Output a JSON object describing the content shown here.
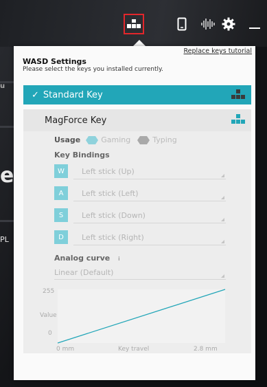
{
  "background": {
    "text_fragments": [
      "u",
      "e",
      "PL"
    ]
  },
  "topbar": {
    "icons": [
      {
        "name": "keyboard-layout-icon",
        "active": true
      },
      {
        "name": "device-icon",
        "active": false
      },
      {
        "name": "sound-wave-icon",
        "active": false
      },
      {
        "name": "gear-icon",
        "active": false
      },
      {
        "name": "minimize-icon",
        "active": false
      }
    ]
  },
  "panel": {
    "tutorial_link": "Replace keys tutorial",
    "title": "WASD Settings",
    "subtitle": "Please select the keys you installed currently.",
    "options": {
      "standard": {
        "label": "Standard Key",
        "selected": true
      },
      "magforce": {
        "label": "MagForce Key",
        "selected": false
      }
    },
    "usage": {
      "label": "Usage",
      "gaming": "Gaming",
      "typing": "Typing"
    },
    "bindings": {
      "label": "Key Bindings",
      "rows": [
        {
          "key": "W",
          "value": "Left stick (Up)"
        },
        {
          "key": "A",
          "value": "Left stick (Left)"
        },
        {
          "key": "S",
          "value": "Left stick (Down)"
        },
        {
          "key": "D",
          "value": "Left stick (Right)"
        }
      ]
    },
    "analog": {
      "label": "Analog curve",
      "info": "i",
      "selected": "Linear (Default)"
    },
    "chart_labels": {
      "y_max": "255",
      "y_label": "Value",
      "y_min": "0",
      "x_min": "0 mm",
      "x_label": "Key travel",
      "x_max": "2.8 mm"
    }
  },
  "colors": {
    "accent": "#22a6b8",
    "accent_light": "#7fcfda",
    "highlight_border": "#e3262b"
  },
  "chart_data": {
    "type": "line",
    "title": "",
    "xlabel": "Key travel",
    "ylabel": "Value",
    "x": [
      0,
      2.8
    ],
    "series": [
      {
        "values": [
          0,
          255
        ]
      }
    ],
    "xlim": [
      0,
      2.8
    ],
    "ylim": [
      0,
      255
    ],
    "x_tick_labels": [
      "0 mm",
      "2.8 mm"
    ],
    "y_tick_labels": [
      "0",
      "255"
    ]
  }
}
